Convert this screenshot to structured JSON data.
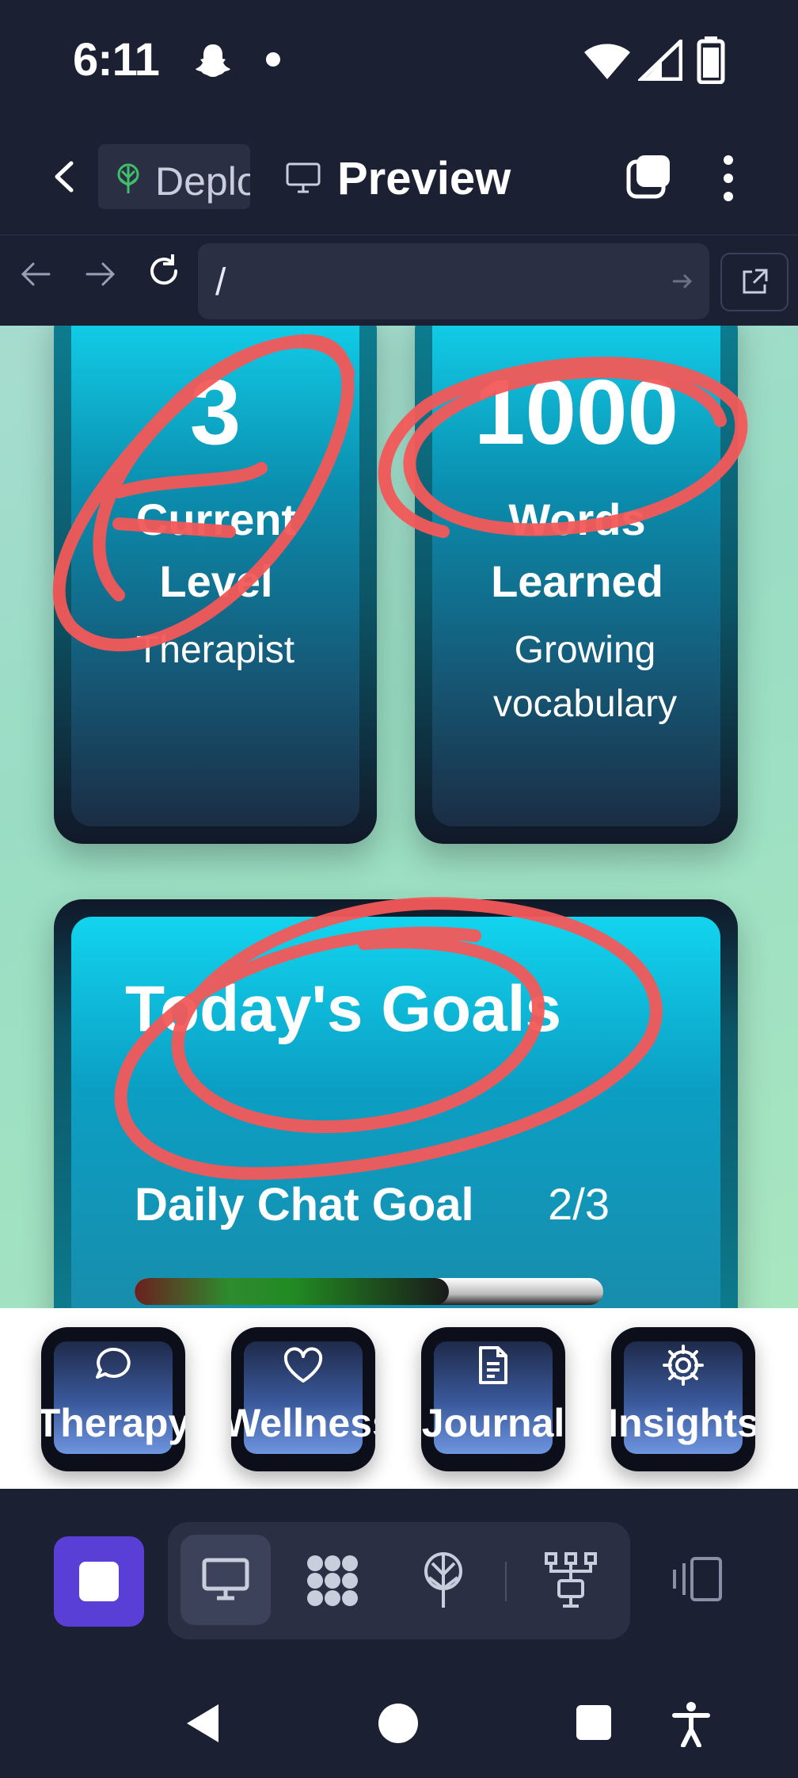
{
  "status_bar": {
    "time": "6:11"
  },
  "browser": {
    "tabs": [
      {
        "label": "Deploy",
        "icon": "deploy-tree-icon"
      },
      {
        "label": "Preview",
        "icon": "monitor-icon"
      }
    ],
    "url": "/"
  },
  "stats": [
    {
      "value": "3",
      "label": "Current Level",
      "sub": "Therapist"
    },
    {
      "value": "1000",
      "label": "Words Learned",
      "sub": "Growing vocabulary"
    }
  ],
  "goals": {
    "title": "Today's Goals",
    "items": [
      {
        "name": "Daily Chat Goal",
        "count": "2/3",
        "progress": 0.67
      }
    ]
  },
  "nav": [
    {
      "label": "Therapy",
      "icon": "chat-bubble-icon"
    },
    {
      "label": "Wellness",
      "icon": "heart-icon"
    },
    {
      "label": "Journal",
      "icon": "document-icon"
    },
    {
      "label": "Insights",
      "icon": "gear-icon"
    }
  ],
  "colors": {
    "background": "#1c2033",
    "card_accent": "#12d4ee",
    "stop_button": "#5a3fd6",
    "annotation": "#f35858"
  }
}
